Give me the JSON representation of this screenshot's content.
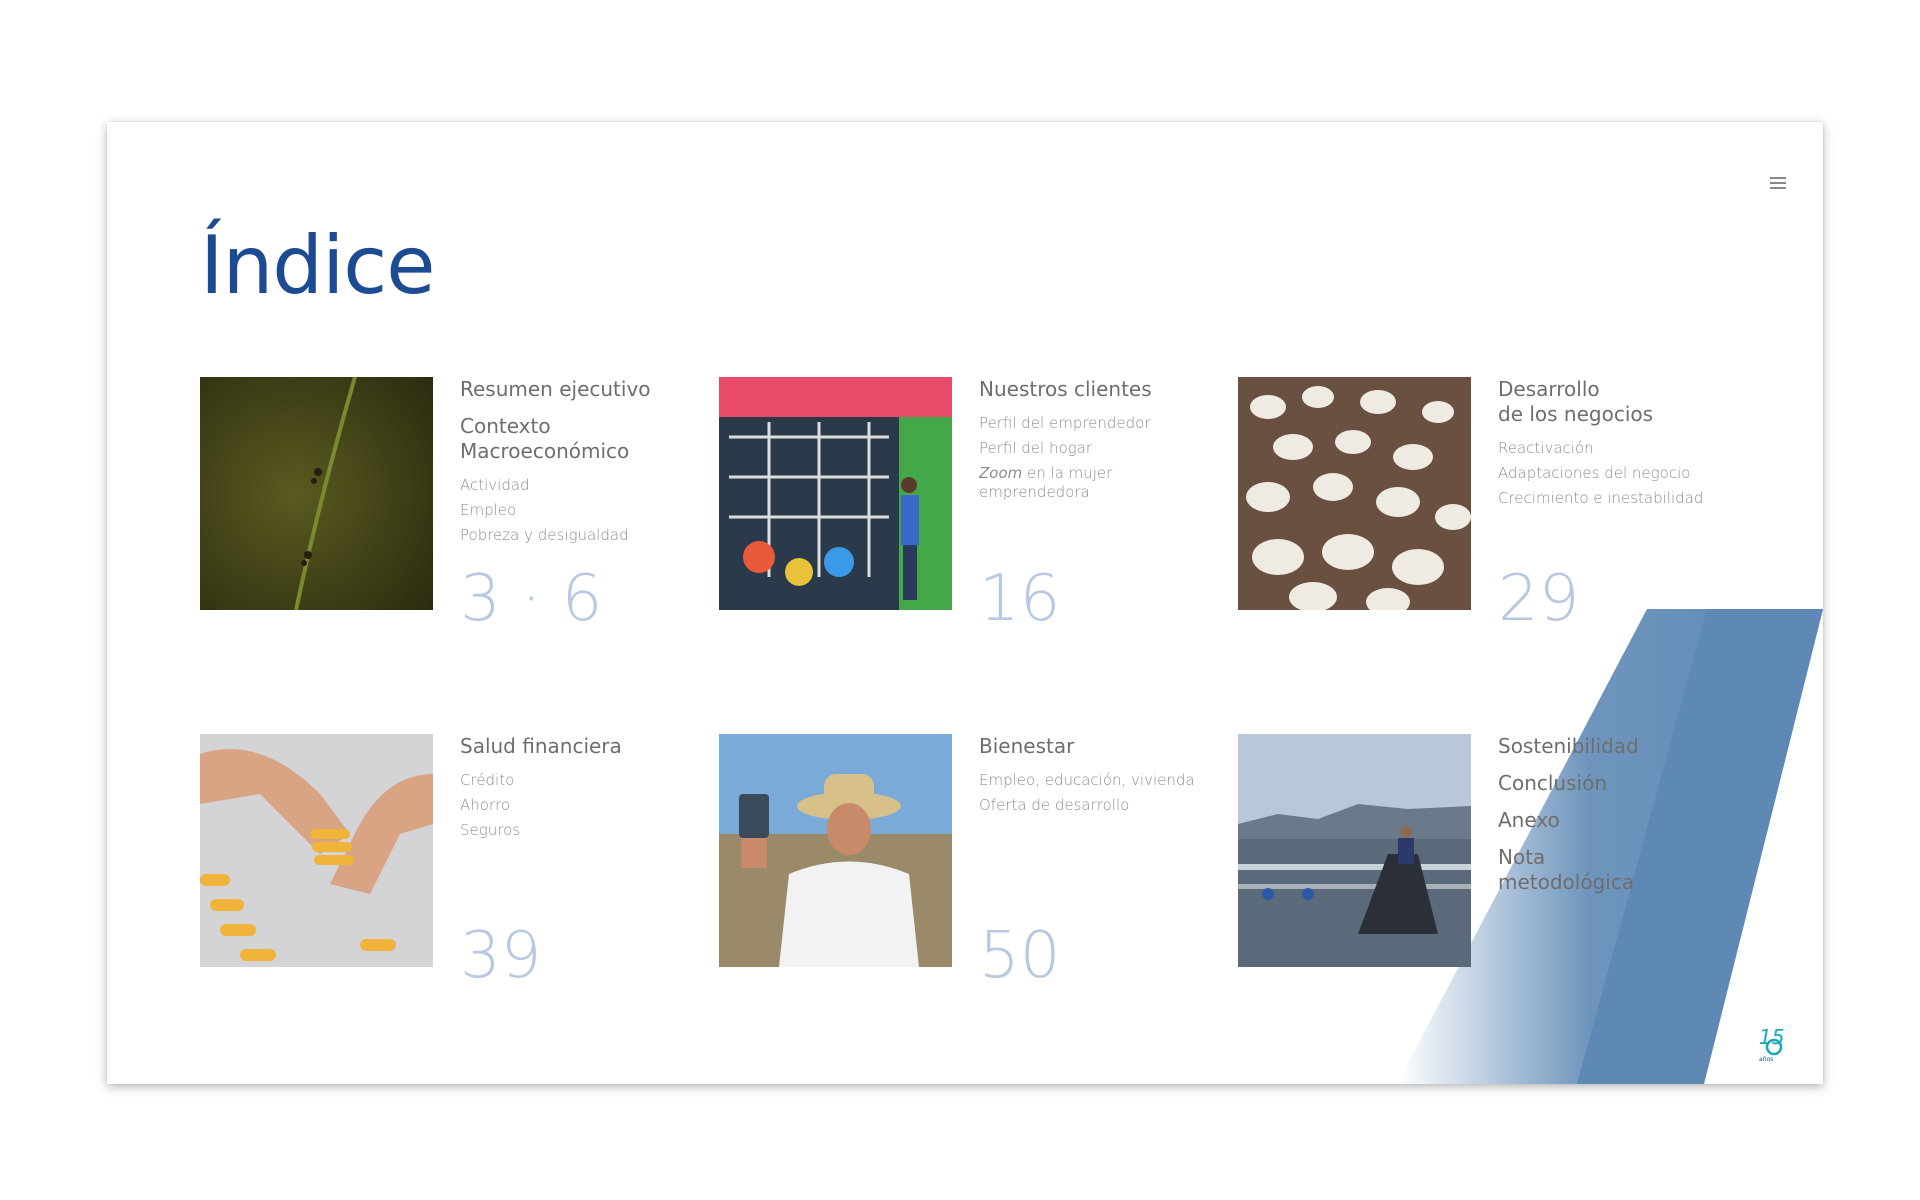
{
  "title": "Índice",
  "colors": {
    "title": "#1c4a93",
    "heading": "#6e6e6e",
    "subitem": "#8d8d8d",
    "page_number": "#b7c9e2",
    "accent_stripe": "#5e89b5",
    "logo": "#18a7b5"
  },
  "menu_icon": "hamburger-menu-icon",
  "sections": [
    {
      "photo": "plant-stem-with-ants",
      "headings": [
        {
          "title": "Resumen ejecutivo",
          "items": []
        },
        {
          "title": "Contexto\nMacroeconómico",
          "items": [
            "Actividad",
            "Empleo",
            "Pobreza y desigualdad"
          ]
        }
      ],
      "page": "3 · 6"
    },
    {
      "photo": "recycling-shop-storefront",
      "headings": [
        {
          "title": "Nuestros clientes",
          "items": [
            "Perfil del emprendedor",
            "Perfil del hogar"
          ]
        }
      ],
      "italic_item": {
        "em": "Zoom",
        "rest": " en la mujer\nemprendedora"
      },
      "page": "16"
    },
    {
      "photo": "white-chickens-farm",
      "headings": [
        {
          "title": "Desarrollo\nde los negocios",
          "items": [
            "Reactivación",
            "Adaptaciones del negocio",
            "Crecimiento e inestabilidad"
          ]
        }
      ],
      "page": "29"
    },
    {
      "photo": "hands-shaping-dough",
      "headings": [
        {
          "title": "Salud financiera",
          "items": [
            "Crédito",
            "Ahorro",
            "Seguros"
          ]
        }
      ],
      "page": "39"
    },
    {
      "photo": "woman-holding-jar",
      "headings": [
        {
          "title": "Bienestar",
          "items": [
            "Empleo, educación, vivienda",
            "Oferta de desarrollo"
          ]
        }
      ],
      "page": "50"
    },
    {
      "photo": "fish-farm-lake",
      "headings": [
        {
          "title": "Sostenibilidad",
          "items": []
        },
        {
          "title": "Conclusión",
          "items": []
        },
        {
          "title": "Anexo",
          "items": []
        },
        {
          "title": "Nota\nmetodológica",
          "items": []
        }
      ],
      "page": ""
    }
  ],
  "logo": {
    "number": "15",
    "tagline": "años",
    "icon": "anniversary-logo-icon"
  }
}
